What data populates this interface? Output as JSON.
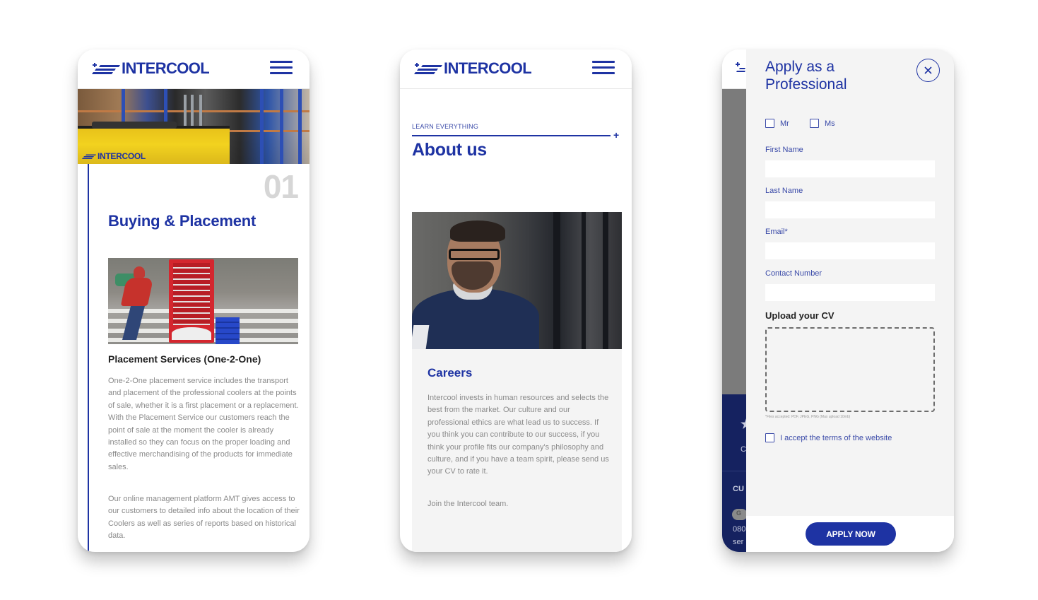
{
  "brand": {
    "name": "INTERCOOL",
    "primary_color": "#1e33a3",
    "footer_color": "#152260"
  },
  "icons": {
    "logo": "intercool-logo-icon",
    "menu": "hamburger-menu-icon",
    "close": "close-circle-icon",
    "plus": "plus-icon"
  },
  "screen1": {
    "hero_badge": "INTERCOOL",
    "step_number": "01",
    "section_title": "Buying & Placement",
    "subtitle": "Placement Services (One-2-One)",
    "paragraph1": "One-2-One placement service includes the transport and placement of the professional coolers at the points of sale, whether it is a first placement or a replacement. With the Placement Service our customers reach the point of sale at the moment the cooler is already installed so they can focus on the proper loading and effective merchandising of the products for immediate sales.",
    "paragraph2": "Our online management platform AMT gives access to our customers to detailed info about the location of their Coolers as well as series of reports based on historical data."
  },
  "screen2": {
    "eyebrow": "LEARN EVERYTHING",
    "plus": "+",
    "page_title": "About us",
    "card_title": "Careers",
    "paragraph1": "Intercool invests in human resources and selects the best from the market. Our culture and our professional ethics are what lead us to success. If you think you can contribute to our success, if you think your profile fits our company's philosophy and culture, and if you have a team spirit, please send us your CV to rate it.",
    "paragraph2": "Join the Intercool team."
  },
  "screen3": {
    "background_fragments": {
      "footer_heading": "CU",
      "chip": "G",
      "line1": "080",
      "line2": "ser",
      "mid": "C"
    },
    "title": "Apply as a Professional",
    "salutations": [
      {
        "label": "Mr",
        "checked": false
      },
      {
        "label": "Ms",
        "checked": false
      }
    ],
    "fields": [
      {
        "label": "First Name",
        "value": "",
        "placeholder": ""
      },
      {
        "label": "Last Name",
        "value": "",
        "placeholder": ""
      },
      {
        "label": "Email*",
        "value": "",
        "placeholder": ""
      },
      {
        "label": "Contact Number",
        "value": "",
        "placeholder": ""
      }
    ],
    "upload_title": "Upload your CV",
    "upload_note": "*Files accepted: PDF, JPEG, PNG (Max upload 10mb)",
    "terms_label": "I accept the terms of the website",
    "terms_checked": false,
    "submit_label": "APPLY NOW"
  }
}
